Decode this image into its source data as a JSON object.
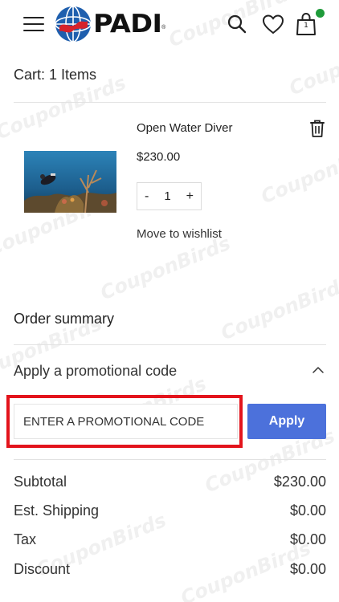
{
  "header": {
    "logo_text": "PADI",
    "logo_registered": "®",
    "icons": {
      "menu": "hamburger-menu-icon",
      "search": "search-icon",
      "wishlist": "heart-icon",
      "bag": "shopping-bag-icon"
    },
    "bag_count": "1",
    "bag_indicator_color": "#1f9b3a"
  },
  "cart": {
    "title": "Cart: 1 Items",
    "items": [
      {
        "name": "Open Water Diver",
        "price": "$230.00",
        "quantity": "1",
        "qty_minus": "-",
        "qty_plus": "+",
        "move_to_wishlist": "Move to wishlist",
        "delete_icon": "trash-icon"
      }
    ]
  },
  "summary": {
    "title": "Order summary",
    "promo_toggle_label": "Apply a promotional code",
    "promo_placeholder": "ENTER A PROMOTIONAL CODE",
    "promo_value": "",
    "apply_label": "Apply",
    "rows": [
      {
        "label": "Subtotal",
        "value": "$230.00"
      },
      {
        "label": "Est. Shipping",
        "value": "$0.00"
      },
      {
        "label": "Tax",
        "value": "$0.00"
      },
      {
        "label": "Discount",
        "value": "$0.00"
      }
    ]
  },
  "colors": {
    "accent": "#4c71db",
    "highlight": "#e3141c"
  },
  "watermark": "CouponBirds"
}
